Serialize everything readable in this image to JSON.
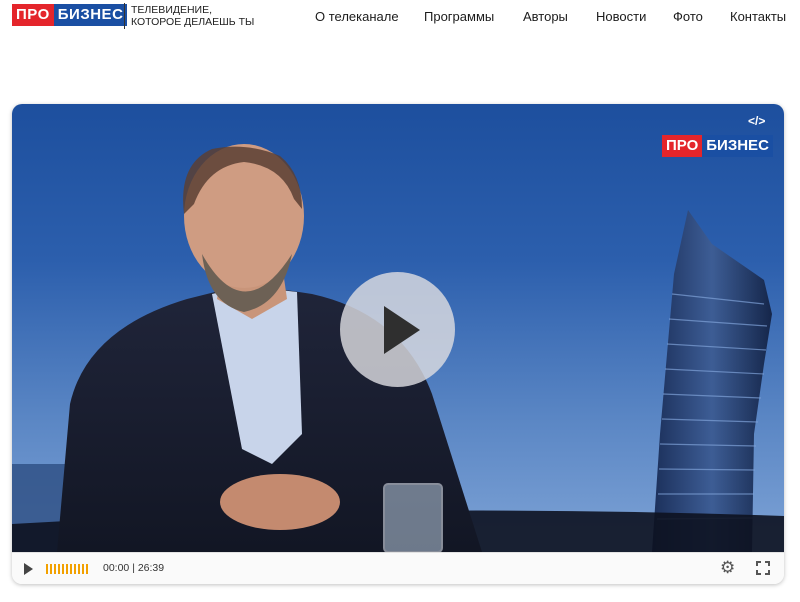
{
  "logo": {
    "pro": "ПРО",
    "biznes": "БИЗНЕС"
  },
  "tagline": {
    "line1": "ТЕЛЕВИДЕНИЕ,",
    "line2": "КОТОРОЕ ДЕЛАЕШЬ ТЫ"
  },
  "nav": [
    "О телеканале",
    "Программы",
    "Авторы",
    "Новости",
    "Фото",
    "Контакты"
  ],
  "player": {
    "watermark_pro": "ПРО",
    "watermark_biznes": "БИЗНЕС",
    "embed_label": "</>",
    "time": "00:00 | 26:39",
    "volume_bars": 11
  },
  "colors": {
    "brand_red": "#e4252b",
    "brand_blue": "#1a4fa3",
    "volume": "#f2a100"
  }
}
